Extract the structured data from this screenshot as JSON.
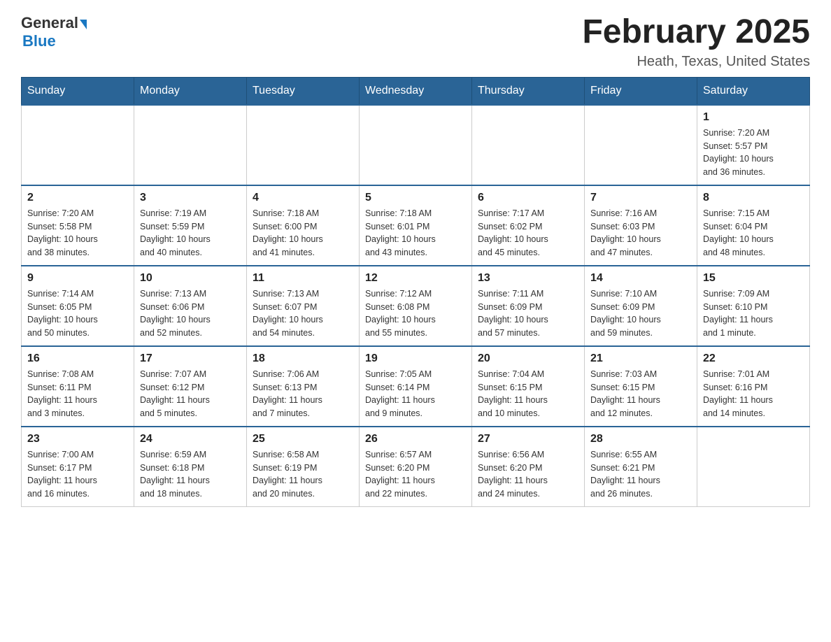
{
  "header": {
    "logo_general": "General",
    "logo_blue": "Blue",
    "title": "February 2025",
    "location": "Heath, Texas, United States"
  },
  "days_of_week": [
    "Sunday",
    "Monday",
    "Tuesday",
    "Wednesday",
    "Thursday",
    "Friday",
    "Saturday"
  ],
  "weeks": [
    [
      {
        "day": "",
        "info": ""
      },
      {
        "day": "",
        "info": ""
      },
      {
        "day": "",
        "info": ""
      },
      {
        "day": "",
        "info": ""
      },
      {
        "day": "",
        "info": ""
      },
      {
        "day": "",
        "info": ""
      },
      {
        "day": "1",
        "info": "Sunrise: 7:20 AM\nSunset: 5:57 PM\nDaylight: 10 hours\nand 36 minutes."
      }
    ],
    [
      {
        "day": "2",
        "info": "Sunrise: 7:20 AM\nSunset: 5:58 PM\nDaylight: 10 hours\nand 38 minutes."
      },
      {
        "day": "3",
        "info": "Sunrise: 7:19 AM\nSunset: 5:59 PM\nDaylight: 10 hours\nand 40 minutes."
      },
      {
        "day": "4",
        "info": "Sunrise: 7:18 AM\nSunset: 6:00 PM\nDaylight: 10 hours\nand 41 minutes."
      },
      {
        "day": "5",
        "info": "Sunrise: 7:18 AM\nSunset: 6:01 PM\nDaylight: 10 hours\nand 43 minutes."
      },
      {
        "day": "6",
        "info": "Sunrise: 7:17 AM\nSunset: 6:02 PM\nDaylight: 10 hours\nand 45 minutes."
      },
      {
        "day": "7",
        "info": "Sunrise: 7:16 AM\nSunset: 6:03 PM\nDaylight: 10 hours\nand 47 minutes."
      },
      {
        "day": "8",
        "info": "Sunrise: 7:15 AM\nSunset: 6:04 PM\nDaylight: 10 hours\nand 48 minutes."
      }
    ],
    [
      {
        "day": "9",
        "info": "Sunrise: 7:14 AM\nSunset: 6:05 PM\nDaylight: 10 hours\nand 50 minutes."
      },
      {
        "day": "10",
        "info": "Sunrise: 7:13 AM\nSunset: 6:06 PM\nDaylight: 10 hours\nand 52 minutes."
      },
      {
        "day": "11",
        "info": "Sunrise: 7:13 AM\nSunset: 6:07 PM\nDaylight: 10 hours\nand 54 minutes."
      },
      {
        "day": "12",
        "info": "Sunrise: 7:12 AM\nSunset: 6:08 PM\nDaylight: 10 hours\nand 55 minutes."
      },
      {
        "day": "13",
        "info": "Sunrise: 7:11 AM\nSunset: 6:09 PM\nDaylight: 10 hours\nand 57 minutes."
      },
      {
        "day": "14",
        "info": "Sunrise: 7:10 AM\nSunset: 6:09 PM\nDaylight: 10 hours\nand 59 minutes."
      },
      {
        "day": "15",
        "info": "Sunrise: 7:09 AM\nSunset: 6:10 PM\nDaylight: 11 hours\nand 1 minute."
      }
    ],
    [
      {
        "day": "16",
        "info": "Sunrise: 7:08 AM\nSunset: 6:11 PM\nDaylight: 11 hours\nand 3 minutes."
      },
      {
        "day": "17",
        "info": "Sunrise: 7:07 AM\nSunset: 6:12 PM\nDaylight: 11 hours\nand 5 minutes."
      },
      {
        "day": "18",
        "info": "Sunrise: 7:06 AM\nSunset: 6:13 PM\nDaylight: 11 hours\nand 7 minutes."
      },
      {
        "day": "19",
        "info": "Sunrise: 7:05 AM\nSunset: 6:14 PM\nDaylight: 11 hours\nand 9 minutes."
      },
      {
        "day": "20",
        "info": "Sunrise: 7:04 AM\nSunset: 6:15 PM\nDaylight: 11 hours\nand 10 minutes."
      },
      {
        "day": "21",
        "info": "Sunrise: 7:03 AM\nSunset: 6:15 PM\nDaylight: 11 hours\nand 12 minutes."
      },
      {
        "day": "22",
        "info": "Sunrise: 7:01 AM\nSunset: 6:16 PM\nDaylight: 11 hours\nand 14 minutes."
      }
    ],
    [
      {
        "day": "23",
        "info": "Sunrise: 7:00 AM\nSunset: 6:17 PM\nDaylight: 11 hours\nand 16 minutes."
      },
      {
        "day": "24",
        "info": "Sunrise: 6:59 AM\nSunset: 6:18 PM\nDaylight: 11 hours\nand 18 minutes."
      },
      {
        "day": "25",
        "info": "Sunrise: 6:58 AM\nSunset: 6:19 PM\nDaylight: 11 hours\nand 20 minutes."
      },
      {
        "day": "26",
        "info": "Sunrise: 6:57 AM\nSunset: 6:20 PM\nDaylight: 11 hours\nand 22 minutes."
      },
      {
        "day": "27",
        "info": "Sunrise: 6:56 AM\nSunset: 6:20 PM\nDaylight: 11 hours\nand 24 minutes."
      },
      {
        "day": "28",
        "info": "Sunrise: 6:55 AM\nSunset: 6:21 PM\nDaylight: 11 hours\nand 26 minutes."
      },
      {
        "day": "",
        "info": ""
      }
    ]
  ]
}
